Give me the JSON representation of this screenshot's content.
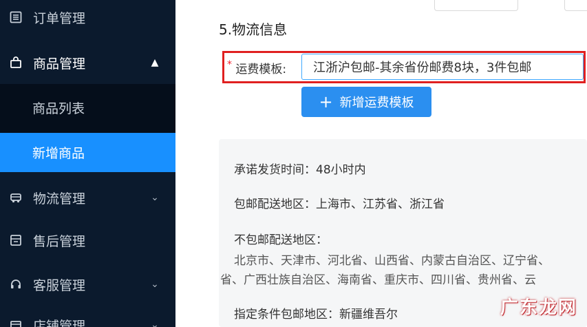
{
  "sidebar": {
    "items": [
      {
        "label": "订单管理",
        "icon": "order-list-icon",
        "expanded": false
      },
      {
        "label": "商品管理",
        "icon": "shopping-bag-icon",
        "expanded": true,
        "children": [
          "商品列表",
          "新增商品"
        ],
        "active_child": "新增商品"
      },
      {
        "label": "物流管理",
        "icon": "truck-icon",
        "expanded": false
      },
      {
        "label": "售后管理",
        "icon": "after-sales-icon",
        "expanded": false
      },
      {
        "label": "客服管理",
        "icon": "headset-icon",
        "expanded": false
      },
      {
        "label": "店铺管理",
        "icon": "store-icon",
        "expanded": false
      }
    ]
  },
  "logistics": {
    "section_title": "5.物流信息",
    "template_label": "运费模板:",
    "required_mark": "*",
    "template_value": "江浙沪包邮-其余省份邮费8块，3件包邮",
    "add_button_label": "新增运费模板"
  },
  "info_panel": {
    "ship_time": "承诺发货时间：48小时内",
    "free_regions": "包邮配送地区：上海市、江苏省、浙江省",
    "non_free_title": "不包邮配送地区：",
    "non_free_line1": "北京市、天津市、河北省、山西省、内蒙古自治区、辽宁省、",
    "non_free_line2": "省、广西壮族自治区、海南省、重庆市、四川省、贵州省、云",
    "conditional": "指定条件包邮地区：新疆维吾尔"
  },
  "watermark": "广东龙网",
  "colors": {
    "sidebar_bg": "#0b1a2d",
    "active": "#1890ff",
    "highlight": "#e02020"
  }
}
